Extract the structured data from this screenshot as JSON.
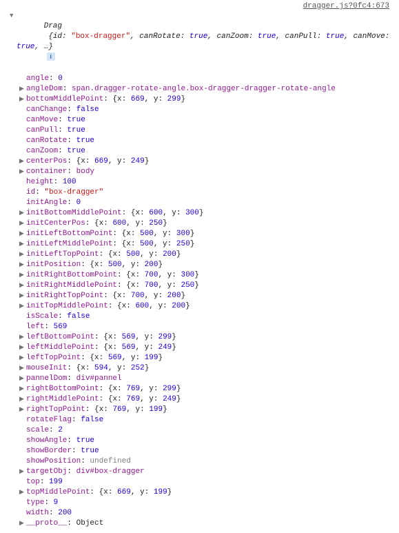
{
  "sourceLink": "dragger.js?0fc4:673",
  "header": {
    "className": "Drag",
    "preview_before_id": "{id: ",
    "id_value": "\"box-dragger\"",
    "after_id": ", canRotate: ",
    "canRotate": "true",
    "sep1": ", canZoom: ",
    "canZoom": "true",
    "sep2": ", canPull: ",
    "canPull": "true",
    "sep3": ", canMove: ",
    "canMove": "true",
    "tail": ", …}"
  },
  "rows": [
    {
      "exp": false,
      "type": "kv-num",
      "name": "angle",
      "value": "0"
    },
    {
      "exp": true,
      "type": "kv-dom",
      "name": "angleDom",
      "value": "span.dragger-rotate-angle.box-dragger-dragger-rotate-angle"
    },
    {
      "exp": true,
      "type": "kv-point",
      "name": "bottomMiddlePoint",
      "x": "669",
      "y": "299"
    },
    {
      "exp": false,
      "type": "kv-num",
      "name": "canChange",
      "value": "false"
    },
    {
      "exp": false,
      "type": "kv-num",
      "name": "canMove",
      "value": "true"
    },
    {
      "exp": false,
      "type": "kv-num",
      "name": "canPull",
      "value": "true"
    },
    {
      "exp": false,
      "type": "kv-num",
      "name": "canRotate",
      "value": "true"
    },
    {
      "exp": false,
      "type": "kv-num",
      "name": "canZoom",
      "value": "true"
    },
    {
      "exp": true,
      "type": "kv-point",
      "name": "centerPos",
      "x": "669",
      "y": "249"
    },
    {
      "exp": true,
      "type": "kv-dom",
      "name": "container",
      "value": "body"
    },
    {
      "exp": false,
      "type": "kv-num",
      "name": "height",
      "value": "100"
    },
    {
      "exp": false,
      "type": "kv-str",
      "name": "id",
      "value": "\"box-dragger\""
    },
    {
      "exp": false,
      "type": "kv-num",
      "name": "initAngle",
      "value": "0"
    },
    {
      "exp": true,
      "type": "kv-point",
      "name": "initBottomMiddlePoint",
      "x": "600",
      "y": "300"
    },
    {
      "exp": true,
      "type": "kv-point",
      "name": "initCenterPos",
      "x": "600",
      "y": "250"
    },
    {
      "exp": true,
      "type": "kv-point",
      "name": "initLeftBottomPoint",
      "x": "500",
      "y": "300"
    },
    {
      "exp": true,
      "type": "kv-point",
      "name": "initLeftMiddlePoint",
      "x": "500",
      "y": "250"
    },
    {
      "exp": true,
      "type": "kv-point",
      "name": "initLeftTopPoint",
      "x": "500",
      "y": "200"
    },
    {
      "exp": true,
      "type": "kv-point",
      "name": "initPosition",
      "x": "500",
      "y": "200"
    },
    {
      "exp": true,
      "type": "kv-point",
      "name": "initRightBottomPoint",
      "x": "700",
      "y": "300"
    },
    {
      "exp": true,
      "type": "kv-point",
      "name": "initRightMiddlePoint",
      "x": "700",
      "y": "250"
    },
    {
      "exp": true,
      "type": "kv-point",
      "name": "initRightTopPoint",
      "x": "700",
      "y": "200"
    },
    {
      "exp": true,
      "type": "kv-point",
      "name": "initTopMiddlePoint",
      "x": "600",
      "y": "200"
    },
    {
      "exp": false,
      "type": "kv-num",
      "name": "isScale",
      "value": "false"
    },
    {
      "exp": false,
      "type": "kv-num",
      "name": "left",
      "value": "569"
    },
    {
      "exp": true,
      "type": "kv-point",
      "name": "leftBottomPoint",
      "x": "569",
      "y": "299"
    },
    {
      "exp": true,
      "type": "kv-point",
      "name": "leftMiddlePoint",
      "x": "569",
      "y": "249"
    },
    {
      "exp": true,
      "type": "kv-point",
      "name": "leftTopPoint",
      "x": "569",
      "y": "199"
    },
    {
      "exp": true,
      "type": "kv-point",
      "name": "mouseInit",
      "x": "594",
      "y": "252"
    },
    {
      "exp": true,
      "type": "kv-dom",
      "name": "pannelDom",
      "value": "div#pannel"
    },
    {
      "exp": true,
      "type": "kv-point",
      "name": "rightBottomPoint",
      "x": "769",
      "y": "299"
    },
    {
      "exp": true,
      "type": "kv-point",
      "name": "rightMiddlePoint",
      "x": "769",
      "y": "249"
    },
    {
      "exp": true,
      "type": "kv-point",
      "name": "rightTopPoint",
      "x": "769",
      "y": "199"
    },
    {
      "exp": false,
      "type": "kv-num",
      "name": "rotateFlag",
      "value": "false"
    },
    {
      "exp": false,
      "type": "kv-num",
      "name": "scale",
      "value": "2"
    },
    {
      "exp": false,
      "type": "kv-num",
      "name": "showAngle",
      "value": "true"
    },
    {
      "exp": false,
      "type": "kv-num",
      "name": "showBorder",
      "value": "true"
    },
    {
      "exp": false,
      "type": "kv-undef",
      "name": "showPosition",
      "value": "undefined"
    },
    {
      "exp": true,
      "type": "kv-dom",
      "name": "targetObj",
      "value": "div#box-dragger"
    },
    {
      "exp": false,
      "type": "kv-num",
      "name": "top",
      "value": "199"
    },
    {
      "exp": true,
      "type": "kv-point",
      "name": "topMiddlePoint",
      "x": "669",
      "y": "199"
    },
    {
      "exp": false,
      "type": "kv-num",
      "name": "type",
      "value": "9"
    },
    {
      "exp": false,
      "type": "kv-num",
      "name": "width",
      "value": "200"
    },
    {
      "exp": true,
      "type": "kv-obj",
      "name": "__proto__",
      "value": "Object"
    }
  ],
  "glyphs": {
    "caret_right": "▶",
    "caret_down": "▼",
    "info": "i"
  }
}
